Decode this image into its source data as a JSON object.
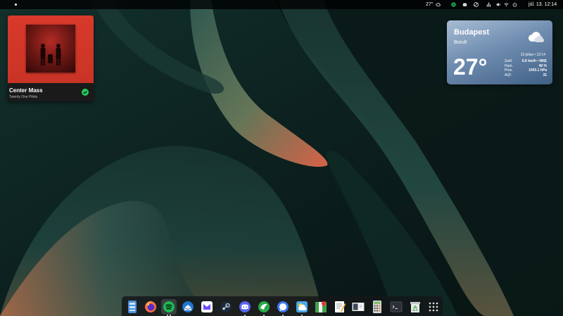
{
  "topbar": {
    "temperature": "27°",
    "clock": "júl. 13.  12:14",
    "tray_icons": [
      "cloud-icon",
      "spotify-tray-icon",
      "discord-tray-icon",
      "steam-tray-icon",
      "updates-tray-icon",
      "network-tray-icon",
      "volume-icon",
      "wifi-icon",
      "power-icon"
    ]
  },
  "music_widget": {
    "title": "Center Mass",
    "artist": "Twenty One Pilots",
    "album_art": "album-art",
    "status_icon": "check-circle-icon"
  },
  "weather_widget": {
    "city": "Budapest",
    "condition": "Borult",
    "temperature": "27°",
    "date": "13 július • 12:14",
    "icon": "cloud-icon",
    "stats": [
      {
        "label": "Szél:",
        "value": "6.6 km/h • NNE"
      },
      {
        "label": "Hum.",
        "value": "40 %"
      },
      {
        "label": "Pres.",
        "value": "1003.1 hPa"
      },
      {
        "label": "AQI:",
        "value": "31"
      }
    ]
  },
  "dock": {
    "apps": [
      {
        "name": "files-icon",
        "running": false
      },
      {
        "name": "firefox-icon",
        "running": false
      },
      {
        "name": "spotify-icon",
        "running": true,
        "active": true
      },
      {
        "name": "thunderbird-icon",
        "running": false
      },
      {
        "name": "proton-mail-icon",
        "running": false
      },
      {
        "name": "steam-icon",
        "running": false
      },
      {
        "name": "discord-icon",
        "running": true
      },
      {
        "name": "evolution-icon",
        "running": true
      },
      {
        "name": "signal-icon",
        "running": true
      },
      {
        "name": "weather-app-icon",
        "running": true
      },
      {
        "name": "maps-icon",
        "running": false
      },
      {
        "name": "text-editor-icon",
        "running": false
      },
      {
        "name": "ebook-reader-icon",
        "running": false
      },
      {
        "name": "calculator-icon",
        "running": false
      },
      {
        "name": "terminal-icon",
        "running": false
      },
      {
        "name": "trash-icon",
        "running": false
      },
      {
        "name": "app-grid-icon",
        "running": false
      }
    ]
  },
  "colors": {
    "topbar_bg": "#000000",
    "music_accent": "#d8392b",
    "weather_bg": "#7590b2",
    "wallpaper_base": "#0d1e1c",
    "wallpaper_accent": "#e0664a"
  }
}
